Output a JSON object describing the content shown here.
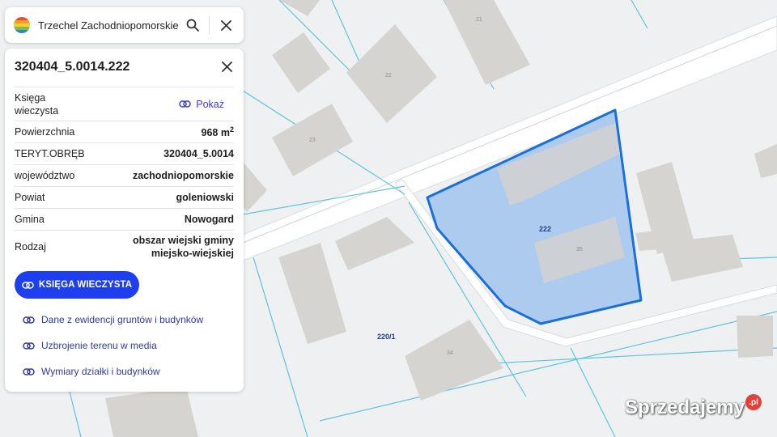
{
  "search": {
    "query": "Trzechel Zachodniopomorskie",
    "search_icon": "search-icon",
    "close_icon": "close-icon"
  },
  "parcel": {
    "title": "320404_5.0014.222",
    "rows": [
      {
        "label": "Księga wieczysta",
        "action": "Pokaż"
      },
      {
        "label": "Powierzchnia",
        "value": "968 m",
        "sup": "2"
      },
      {
        "label": "TERYT.OBRĘB",
        "value": "320404_5.0014"
      },
      {
        "label": "województwo",
        "value": "zachodniopomorskie"
      },
      {
        "label": "Powiat",
        "value": "goleniowski"
      },
      {
        "label": "Gmina",
        "value": "Nowogard"
      },
      {
        "label": "Rodzaj",
        "value": "obszar wiejski gminy miejsko-wiejskiej"
      }
    ],
    "primary_button": "KSIĘGA WIECZYSTA",
    "links": [
      "Dane z ewidencji gruntów i budynków",
      "Uzbrojenie terenu w media",
      "Wymiary działki i budynków"
    ]
  },
  "map": {
    "parcel_label": "222",
    "neighbour_parcel_label": "220/1",
    "building_numbers": [
      "21",
      "22",
      "23",
      "35",
      "34"
    ],
    "colors": {
      "background": "#eef0f1",
      "building": "#d6d4d0",
      "parcel_fill": "#a9c8ee",
      "parcel_stroke": "#1a6fd8",
      "boundary": "#5ec5dc",
      "road": "#ffffff",
      "accent": "#1e3ff0"
    }
  },
  "watermark": {
    "text": "Sprzedajemy",
    "badge": ".pl"
  }
}
